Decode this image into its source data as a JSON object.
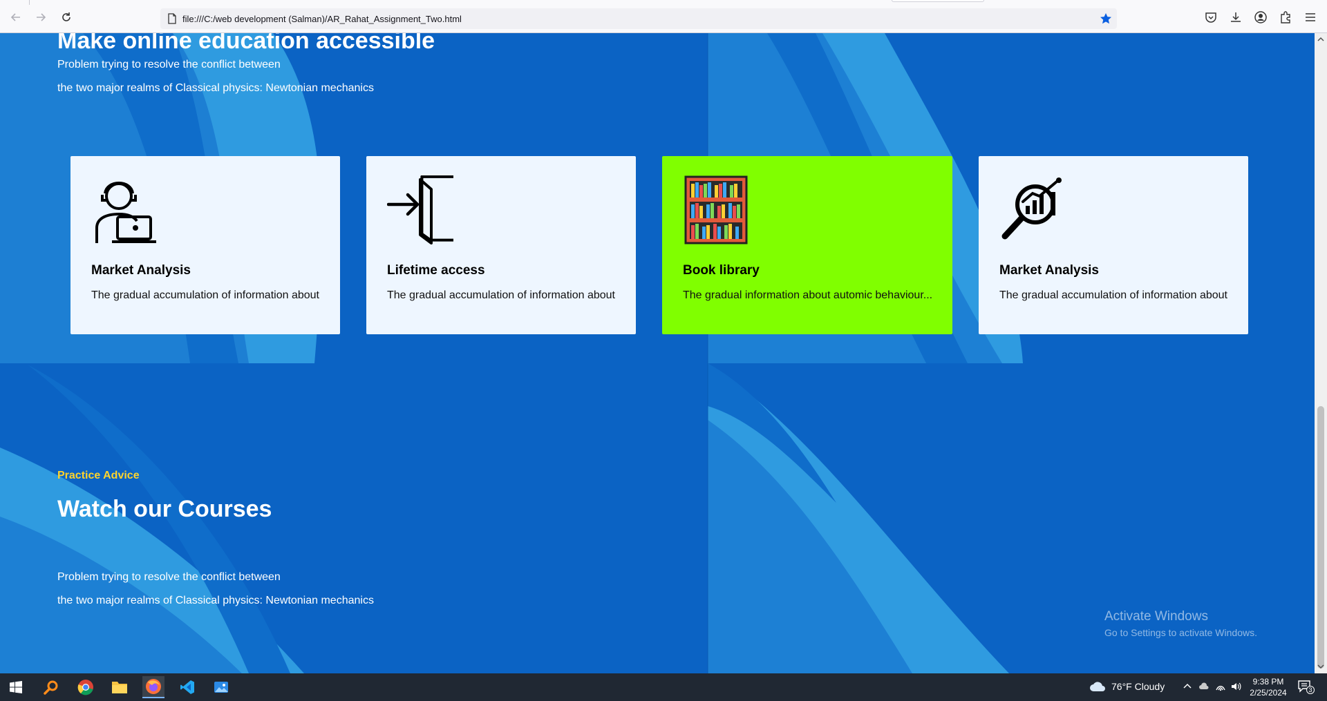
{
  "browser": {
    "url": "file:///C:/web development (Salman)/AR_Rahat_Assignment_Two.html"
  },
  "hero": {
    "title": "Make online education accessible",
    "line1": "Problem trying to resolve the conflict between",
    "line2": "the two major realms of Classical physics: Newtonian mechanics"
  },
  "cards": [
    {
      "title": "Market Analysis",
      "text": "The gradual accumulation of information about",
      "icon": "person-laptop-icon"
    },
    {
      "title": "Lifetime access",
      "text": "The gradual accumulation of information about",
      "icon": "door-enter-icon"
    },
    {
      "title": "Book library",
      "text": "The gradual information about automic behaviour...",
      "icon": "bookshelf-icon"
    },
    {
      "title": "Market Analysis",
      "text": "The gradual accumulation of information about",
      "icon": "magnifier-chart-icon"
    }
  ],
  "courses": {
    "kicker": "Practice Advice",
    "title": "Watch our Courses",
    "line1": "Problem trying to resolve the conflict between",
    "line2": "the two major realms of Classical physics: Newtonian mechanics"
  },
  "watermark": {
    "title": "Activate Windows",
    "subtitle": "Go to Settings to activate Windows."
  },
  "taskbar": {
    "weather": "76°F  Cloudy",
    "time": "9:38 PM",
    "date": "2/25/2024",
    "notifications": "3"
  },
  "colors": {
    "page_bg": "#0b63c4",
    "card_bg": "#eef6ff",
    "card_active": "#80ff00",
    "kicker": "#ffd42a"
  }
}
